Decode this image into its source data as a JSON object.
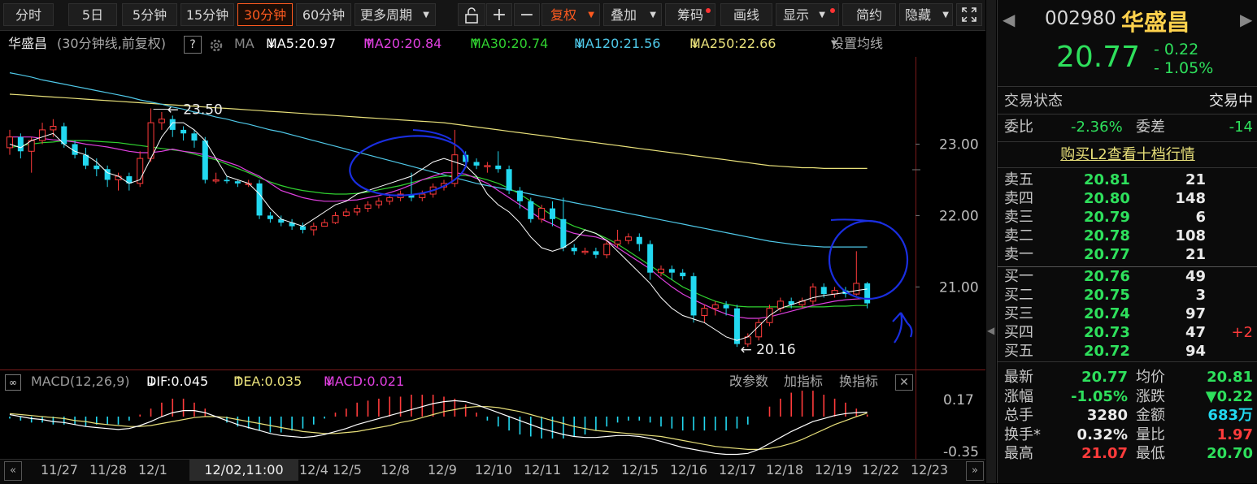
{
  "toolbar": {
    "periods": [
      "分时",
      "5日",
      "5分钟",
      "15分钟",
      "30分钟",
      "60分钟",
      "更多周期"
    ],
    "active_period": "30分钟",
    "tools": [
      "复权",
      "叠加",
      "筹码",
      "画线",
      "显示",
      "简约",
      "隐藏"
    ]
  },
  "legend": {
    "name": "华盛昌",
    "desc": "(30分钟线,前复权)",
    "help": "?",
    "ma": "MA",
    "ma5": "MA5:20.97",
    "ma20": "MA20:20.84",
    "ma30": "MA30:20.74",
    "ma120": "MA120:21.56",
    "ma250": "MA250:22.66",
    "settings": "设置均线"
  },
  "main_chart": {
    "y_ticks": [
      "23.00",
      "22.00",
      "21.00"
    ],
    "high_label": "23.50",
    "low_label": "20.16"
  },
  "macd_legend": {
    "name": "MACD(12,26,9)",
    "dif": "DIF:0.045",
    "dea": "DEA:0.035",
    "macd": "MACD:0.021",
    "actions": [
      "改参数",
      "加指标",
      "换指标"
    ],
    "y_ticks": [
      "0.17",
      "-0.35"
    ]
  },
  "x_axis": {
    "labels": [
      "11/27",
      "11/28",
      "12/1",
      "12/4",
      "12/5",
      "12/8",
      "12/9",
      "12/10",
      "12/11",
      "12/12",
      "12/15",
      "12/16",
      "12/17",
      "12/18",
      "12/19",
      "12/22",
      "12/23"
    ],
    "cursor_label": "12/02,11:00"
  },
  "quote": {
    "code": "002980",
    "name": "华盛昌",
    "price": "20.77",
    "change": "- 0.22",
    "change_pct": "- 1.05%",
    "status_label": "交易状态",
    "status_value": "交易中",
    "weibi_label": "委比",
    "weibi_value": "-2.36%",
    "weicha_label": "委差",
    "weicha_value": "-14",
    "l2_link": "购买L2查看十档行情",
    "asks": [
      {
        "label": "卖五",
        "price": "20.81",
        "vol": "21",
        "delta": ""
      },
      {
        "label": "卖四",
        "price": "20.80",
        "vol": "148",
        "delta": ""
      },
      {
        "label": "卖三",
        "price": "20.79",
        "vol": "6",
        "delta": ""
      },
      {
        "label": "卖二",
        "price": "20.78",
        "vol": "108",
        "delta": ""
      },
      {
        "label": "卖一",
        "price": "20.77",
        "vol": "21",
        "delta": ""
      }
    ],
    "bids": [
      {
        "label": "买一",
        "price": "20.76",
        "vol": "49",
        "delta": ""
      },
      {
        "label": "买二",
        "price": "20.75",
        "vol": "3",
        "delta": ""
      },
      {
        "label": "买三",
        "price": "20.74",
        "vol": "97",
        "delta": ""
      },
      {
        "label": "买四",
        "price": "20.73",
        "vol": "47",
        "delta": "+2"
      },
      {
        "label": "买五",
        "price": "20.72",
        "vol": "94",
        "delta": ""
      }
    ],
    "stats": [
      {
        "l1": "最新",
        "v1": "20.77",
        "l2": "均价",
        "v2": "20.81"
      },
      {
        "l1": "涨幅",
        "v1": "-1.05%",
        "l2": "涨跌",
        "v2": "▼0.22"
      },
      {
        "l1": "总手",
        "v1": "3280",
        "l2": "金额",
        "v2": "683万"
      },
      {
        "l1": "换手*",
        "v1": "0.32%",
        "l2": "量比",
        "v2": "1.97"
      },
      {
        "l1": "最高",
        "v1": "21.07",
        "l2": "最低",
        "v2": "20.70"
      }
    ]
  },
  "colors": {
    "up": "#ff3b3b",
    "down": "#22d8f0",
    "ma5": "#ffffff",
    "ma20": "#e040e0",
    "ma30": "#30d030",
    "ma120": "#4fc8e8",
    "ma250": "#e8e07a",
    "annotation": "#1a2ee0"
  },
  "chart_data": {
    "type": "candlestick",
    "price_labels": {
      "high": 23.5,
      "low": 20.16
    },
    "y_ticks": [
      23.0,
      22.0,
      21.0
    ],
    "ma_lines": {
      "ma5": [
        23.0,
        22.95,
        23.05,
        23.1,
        23.15,
        23.0,
        22.9,
        22.85,
        22.75,
        22.6,
        22.55,
        22.45,
        22.5,
        22.8,
        23.1,
        23.3,
        23.3,
        23.2,
        23.05,
        22.8,
        22.55,
        22.5,
        22.45,
        22.3,
        22.1,
        21.95,
        21.9,
        21.85,
        21.95,
        22.05,
        22.15,
        22.2,
        22.3,
        22.35,
        22.4,
        22.45,
        22.5,
        22.55,
        22.65,
        22.75,
        22.8,
        22.75,
        22.7,
        22.55,
        22.3,
        22.15,
        22.05,
        21.9,
        21.7,
        21.55,
        21.5,
        21.55,
        21.65,
        21.8,
        21.75,
        21.65,
        21.5,
        21.35,
        21.2,
        21.05,
        20.85,
        20.7,
        20.6,
        20.55,
        20.5,
        20.4,
        20.3,
        20.25,
        20.3,
        20.45,
        20.6,
        20.7,
        20.75,
        20.8,
        20.85,
        20.88,
        20.9,
        20.92,
        20.95,
        20.97
      ],
      "ma20": [
        23.1,
        23.1,
        23.1,
        23.08,
        23.06,
        23.05,
        23.03,
        23.0,
        22.98,
        22.96,
        22.93,
        22.9,
        22.88,
        22.88,
        22.9,
        22.93,
        22.9,
        22.88,
        22.85,
        22.8,
        22.75,
        22.7,
        22.62,
        22.55,
        22.45,
        22.35,
        22.3,
        22.25,
        22.22,
        22.2,
        22.2,
        22.21,
        22.22,
        22.25,
        22.28,
        22.32,
        22.37,
        22.43,
        22.5,
        22.55,
        22.6,
        22.6,
        22.58,
        22.52,
        22.45,
        22.35,
        22.25,
        22.15,
        22.05,
        21.95,
        21.88,
        21.8,
        21.75,
        21.72,
        21.7,
        21.65,
        21.55,
        21.45,
        21.35,
        21.25,
        21.12,
        21.0,
        20.9,
        20.82,
        20.75,
        20.68,
        20.62,
        20.58,
        20.56,
        20.56,
        20.58,
        20.62,
        20.66,
        20.7,
        20.74,
        20.77,
        20.8,
        20.82,
        20.83,
        20.84
      ],
      "ma30": [
        22.95,
        22.98,
        23.0,
        23.02,
        23.03,
        23.05,
        23.05,
        23.05,
        23.04,
        23.03,
        23.02,
        23.0,
        22.98,
        22.96,
        22.94,
        22.92,
        22.9,
        22.86,
        22.82,
        22.78,
        22.72,
        22.66,
        22.6,
        22.53,
        22.47,
        22.42,
        22.38,
        22.35,
        22.33,
        22.31,
        22.3,
        22.3,
        22.31,
        22.33,
        22.36,
        22.39,
        22.42,
        22.46,
        22.5,
        22.53,
        22.55,
        22.56,
        22.56,
        22.54,
        22.5,
        22.45,
        22.38,
        22.3,
        22.2,
        22.1,
        22.0,
        21.92,
        21.85,
        21.8,
        21.75,
        21.68,
        21.6,
        21.5,
        21.4,
        21.3,
        21.2,
        21.1,
        21.0,
        20.93,
        20.86,
        20.8,
        20.76,
        20.73,
        20.72,
        20.72,
        20.72,
        20.72,
        20.72,
        20.72,
        20.72,
        20.72,
        20.73,
        20.73,
        20.74,
        20.74
      ],
      "ma120": [
        24.0,
        23.97,
        23.94,
        23.9,
        23.87,
        23.84,
        23.81,
        23.78,
        23.75,
        23.72,
        23.69,
        23.66,
        23.62,
        23.59,
        23.56,
        23.52,
        23.49,
        23.45,
        23.42,
        23.38,
        23.35,
        23.31,
        23.28,
        23.24,
        23.2,
        23.17,
        23.13,
        23.09,
        23.05,
        23.01,
        22.97,
        22.93,
        22.89,
        22.85,
        22.81,
        22.77,
        22.73,
        22.69,
        22.65,
        22.61,
        22.57,
        22.53,
        22.49,
        22.45,
        22.42,
        22.39,
        22.36,
        22.33,
        22.3,
        22.27,
        22.24,
        22.21,
        22.18,
        22.15,
        22.12,
        22.09,
        22.06,
        22.03,
        22.0,
        21.97,
        21.94,
        21.91,
        21.88,
        21.85,
        21.82,
        21.79,
        21.76,
        21.73,
        21.7,
        21.67,
        21.64,
        21.62,
        21.6,
        21.58,
        21.57,
        21.56,
        21.56,
        21.56,
        21.56,
        21.56
      ],
      "ma250": [
        23.7,
        23.69,
        23.68,
        23.67,
        23.66,
        23.65,
        23.64,
        23.63,
        23.62,
        23.61,
        23.6,
        23.59,
        23.58,
        23.57,
        23.56,
        23.55,
        23.54,
        23.53,
        23.52,
        23.51,
        23.5,
        23.49,
        23.48,
        23.47,
        23.46,
        23.45,
        23.44,
        23.43,
        23.42,
        23.41,
        23.4,
        23.39,
        23.38,
        23.37,
        23.36,
        23.35,
        23.34,
        23.33,
        23.32,
        23.31,
        23.3,
        23.28,
        23.26,
        23.24,
        23.22,
        23.2,
        23.18,
        23.16,
        23.14,
        23.12,
        23.1,
        23.08,
        23.06,
        23.04,
        23.02,
        23.0,
        22.98,
        22.96,
        22.94,
        22.92,
        22.9,
        22.88,
        22.86,
        22.84,
        22.82,
        22.8,
        22.78,
        22.76,
        22.74,
        22.72,
        22.7,
        22.69,
        22.68,
        22.67,
        22.67,
        22.66,
        22.66,
        22.66,
        22.66,
        22.66
      ]
    },
    "candles": [
      [
        22.95,
        23.1,
        23.2,
        22.85
      ],
      [
        23.1,
        22.9,
        23.15,
        22.8
      ],
      [
        22.9,
        23.05,
        23.1,
        22.6
      ],
      [
        23.05,
        23.2,
        23.3,
        23.0
      ],
      [
        23.2,
        23.25,
        23.35,
        23.1
      ],
      [
        23.25,
        23.0,
        23.3,
        22.95
      ],
      [
        23.0,
        22.85,
        23.05,
        22.8
      ],
      [
        22.85,
        22.7,
        22.95,
        22.65
      ],
      [
        22.7,
        22.65,
        22.8,
        22.55
      ],
      [
        22.65,
        22.5,
        22.7,
        22.4
      ],
      [
        22.5,
        22.55,
        22.6,
        22.35
      ],
      [
        22.55,
        22.45,
        22.6,
        22.35
      ],
      [
        22.45,
        22.8,
        22.9,
        22.4
      ],
      [
        22.8,
        23.3,
        23.5,
        22.75
      ],
      [
        23.3,
        23.35,
        23.45,
        23.2
      ],
      [
        23.35,
        23.2,
        23.4,
        23.1
      ],
      [
        23.2,
        23.15,
        23.25,
        23.05
      ],
      [
        23.15,
        23.05,
        23.2,
        22.95
      ],
      [
        23.05,
        22.5,
        23.1,
        22.45
      ],
      [
        22.5,
        22.5,
        22.6,
        22.45
      ],
      [
        22.5,
        22.48,
        22.55,
        22.45
      ],
      [
        22.48,
        22.45,
        22.5,
        22.4
      ],
      [
        22.45,
        22.45,
        22.5,
        22.4
      ],
      [
        22.45,
        22.0,
        22.5,
        21.95
      ],
      [
        22.0,
        21.95,
        22.05,
        21.9
      ],
      [
        21.95,
        21.9,
        22.0,
        21.85
      ],
      [
        21.9,
        21.85,
        21.95,
        21.8
      ],
      [
        21.85,
        21.8,
        21.9,
        21.75
      ],
      [
        21.8,
        21.85,
        21.9,
        21.72
      ],
      [
        21.85,
        21.9,
        21.95,
        21.85
      ],
      [
        21.9,
        22.0,
        22.05,
        21.88
      ],
      [
        22.0,
        22.05,
        22.1,
        21.98
      ],
      [
        22.05,
        22.1,
        22.15,
        22.0
      ],
      [
        22.1,
        22.15,
        22.2,
        22.05
      ],
      [
        22.15,
        22.2,
        22.25,
        22.1
      ],
      [
        22.2,
        22.25,
        22.3,
        22.15
      ],
      [
        22.25,
        22.3,
        22.35,
        22.2
      ],
      [
        22.3,
        22.25,
        22.6,
        22.2
      ],
      [
        22.25,
        22.3,
        22.35,
        22.2
      ],
      [
        22.3,
        22.4,
        22.45,
        22.25
      ],
      [
        22.4,
        22.45,
        22.5,
        22.35
      ],
      [
        22.45,
        22.85,
        23.2,
        22.4
      ],
      [
        22.85,
        22.75,
        22.9,
        22.7
      ],
      [
        22.75,
        22.7,
        22.8,
        22.65
      ],
      [
        22.7,
        22.7,
        22.75,
        22.6
      ],
      [
        22.7,
        22.65,
        22.9,
        22.6
      ],
      [
        22.65,
        22.35,
        22.7,
        22.3
      ],
      [
        22.35,
        22.2,
        22.4,
        22.1
      ],
      [
        22.2,
        21.95,
        22.25,
        21.9
      ],
      [
        21.95,
        22.1,
        22.15,
        21.9
      ],
      [
        22.1,
        21.95,
        22.2,
        21.85
      ],
      [
        21.95,
        21.55,
        22.25,
        21.5
      ],
      [
        21.55,
        21.5,
        21.6,
        21.45
      ],
      [
        21.5,
        21.5,
        21.55,
        21.45
      ],
      [
        21.5,
        21.45,
        21.55,
        21.4
      ],
      [
        21.45,
        21.6,
        21.65,
        21.4
      ],
      [
        21.6,
        21.65,
        21.8,
        21.55
      ],
      [
        21.65,
        21.7,
        21.75,
        21.6
      ],
      [
        21.7,
        21.6,
        21.75,
        21.5
      ],
      [
        21.6,
        21.2,
        21.65,
        21.1
      ],
      [
        21.2,
        21.25,
        21.3,
        21.15
      ],
      [
        21.25,
        21.2,
        21.3,
        21.1
      ],
      [
        21.2,
        21.15,
        21.25,
        21.1
      ],
      [
        21.15,
        20.6,
        21.2,
        20.5
      ],
      [
        20.6,
        20.7,
        20.75,
        20.5
      ],
      [
        20.7,
        20.75,
        20.8,
        20.6
      ],
      [
        20.75,
        20.7,
        20.8,
        20.6
      ],
      [
        20.7,
        20.2,
        20.75,
        20.16
      ],
      [
        20.2,
        20.3,
        20.35,
        20.16
      ],
      [
        20.3,
        20.5,
        20.55,
        20.25
      ],
      [
        20.5,
        20.7,
        20.75,
        20.45
      ],
      [
        20.7,
        20.8,
        20.85,
        20.65
      ],
      [
        20.8,
        20.75,
        20.85,
        20.7
      ],
      [
        20.75,
        20.8,
        20.85,
        20.7
      ],
      [
        20.8,
        21.0,
        21.05,
        20.75
      ],
      [
        21.0,
        20.9,
        21.05,
        20.85
      ],
      [
        20.9,
        20.95,
        21.0,
        20.85
      ],
      [
        20.95,
        20.9,
        21.0,
        20.85
      ],
      [
        20.9,
        21.05,
        21.5,
        20.88
      ],
      [
        21.05,
        20.77,
        21.07,
        20.7
      ]
    ],
    "macd": {
      "y_ticks": [
        0.17,
        -0.35
      ],
      "dif": [
        0.02,
        0.0,
        -0.02,
        -0.03,
        -0.05,
        -0.06,
        -0.08,
        -0.1,
        -0.11,
        -0.12,
        -0.13,
        -0.12,
        -0.09,
        -0.05,
        0.0,
        0.04,
        0.06,
        0.06,
        0.04,
        0.0,
        -0.04,
        -0.08,
        -0.11,
        -0.14,
        -0.17,
        -0.19,
        -0.2,
        -0.21,
        -0.2,
        -0.18,
        -0.15,
        -0.12,
        -0.08,
        -0.05,
        -0.02,
        0.01,
        0.04,
        0.07,
        0.1,
        0.13,
        0.15,
        0.16,
        0.15,
        0.12,
        0.08,
        0.04,
        0.0,
        -0.04,
        -0.08,
        -0.12,
        -0.15,
        -0.18,
        -0.2,
        -0.21,
        -0.21,
        -0.2,
        -0.19,
        -0.19,
        -0.2,
        -0.22,
        -0.25,
        -0.28,
        -0.31,
        -0.33,
        -0.35,
        -0.37,
        -0.38,
        -0.38,
        -0.37,
        -0.33,
        -0.27,
        -0.21,
        -0.15,
        -0.1,
        -0.05,
        -0.02,
        0.01,
        0.03,
        0.04,
        0.045
      ],
      "dea": [
        0.03,
        0.02,
        0.01,
        0.0,
        -0.01,
        -0.02,
        -0.04,
        -0.05,
        -0.07,
        -0.08,
        -0.09,
        -0.1,
        -0.1,
        -0.09,
        -0.07,
        -0.05,
        -0.03,
        -0.01,
        0.0,
        0.0,
        -0.01,
        -0.03,
        -0.05,
        -0.07,
        -0.09,
        -0.11,
        -0.13,
        -0.15,
        -0.16,
        -0.17,
        -0.17,
        -0.16,
        -0.15,
        -0.13,
        -0.11,
        -0.09,
        -0.06,
        -0.04,
        -0.01,
        0.02,
        0.05,
        0.07,
        0.09,
        0.1,
        0.1,
        0.09,
        0.07,
        0.05,
        0.02,
        -0.01,
        -0.04,
        -0.07,
        -0.1,
        -0.12,
        -0.14,
        -0.15,
        -0.16,
        -0.17,
        -0.18,
        -0.19,
        -0.2,
        -0.22,
        -0.24,
        -0.26,
        -0.28,
        -0.3,
        -0.31,
        -0.32,
        -0.33,
        -0.33,
        -0.32,
        -0.3,
        -0.27,
        -0.23,
        -0.18,
        -0.13,
        -0.08,
        -0.04,
        0.0,
        0.035
      ]
    }
  }
}
